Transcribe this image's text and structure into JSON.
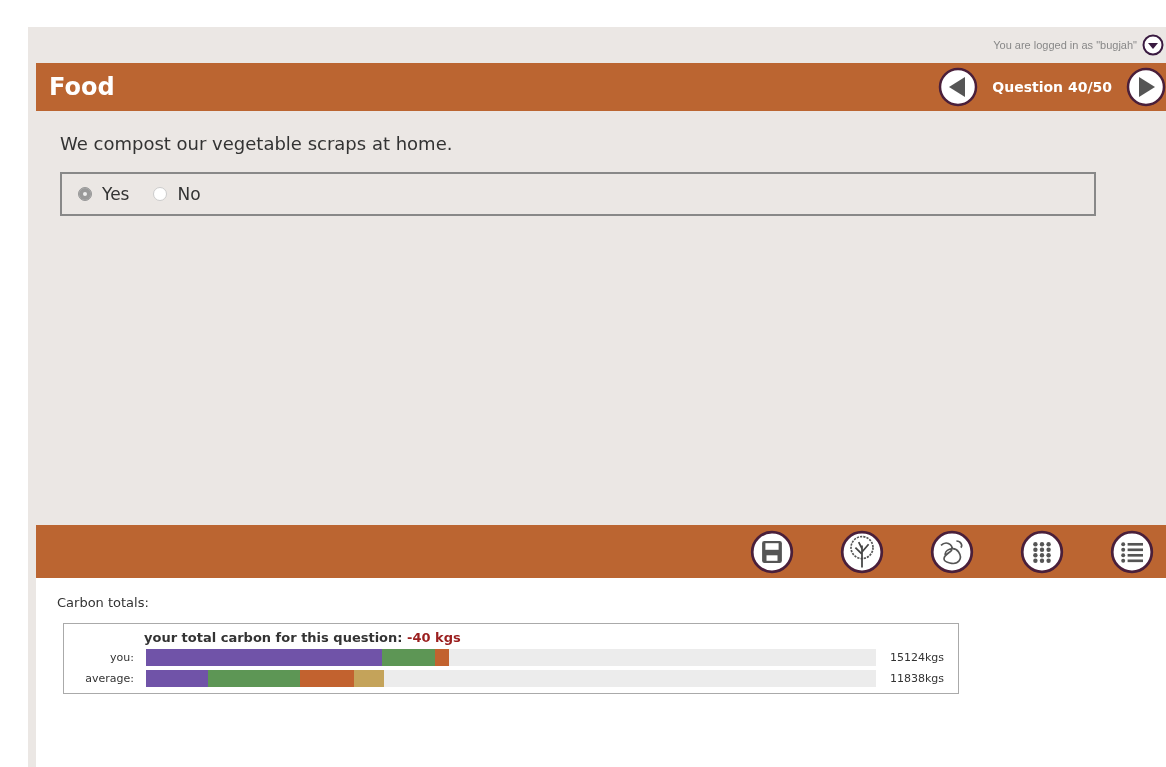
{
  "login": {
    "text": "You are logged in as \"bugjah\""
  },
  "header": {
    "title": "Food",
    "question_label": "Question 40/50"
  },
  "question": {
    "text": "We compost our vegetable scraps at home.",
    "options": [
      {
        "label": "Yes",
        "selected": true
      },
      {
        "label": "No",
        "selected": false
      }
    ]
  },
  "toolbar": {
    "buttons": [
      {
        "kind": "save"
      },
      {
        "kind": "tree"
      },
      {
        "kind": "scribble"
      },
      {
        "kind": "grid"
      },
      {
        "kind": "list"
      }
    ]
  },
  "carbon": {
    "title": "Carbon totals:",
    "caption": "your total carbon for this question:",
    "caption_value": "-40 kgs",
    "rows": [
      {
        "label": "you:",
        "total": "15124kgs",
        "segments": [
          {
            "color": "#7053a8"
          },
          {
            "color": "#5d9655"
          },
          {
            "color": "#c2622f"
          }
        ]
      },
      {
        "label": "average:",
        "total": "11838kgs",
        "segments": [
          {
            "color": "#7053a8"
          },
          {
            "color": "#5d9655"
          },
          {
            "color": "#c2622f"
          },
          {
            "color": "#c4a35a"
          }
        ]
      }
    ]
  }
}
